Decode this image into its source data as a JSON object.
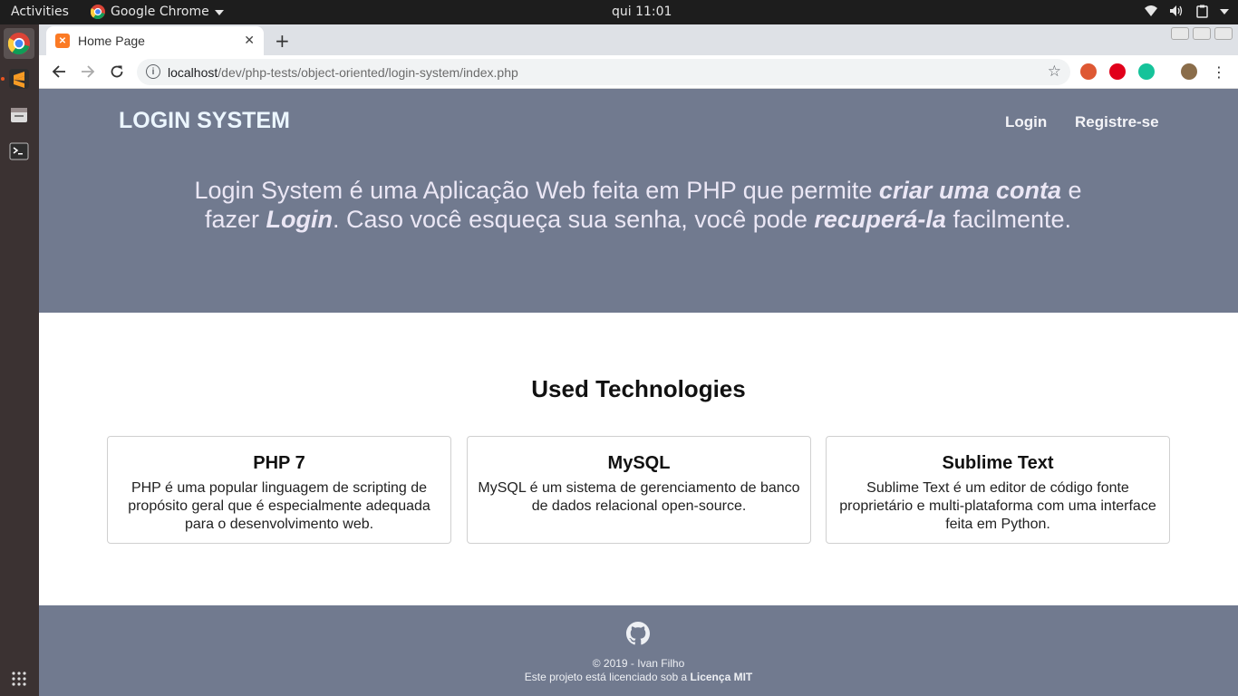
{
  "system": {
    "activities": "Activities",
    "app_name": "Google Chrome",
    "clock": "qui 11:01"
  },
  "browser": {
    "tab_title": "Home Page",
    "url_host": "localhost",
    "url_path": "/dev/php-tests/object-oriented/login-system/index.php"
  },
  "header": {
    "brand": "LOGIN SYSTEM",
    "nav": [
      {
        "label": "Login"
      },
      {
        "label": "Registre-se"
      }
    ]
  },
  "hero": {
    "t1": "Login System é uma Aplicação Web feita em PHP que permite ",
    "b1": "criar uma conta",
    "t2": " e fazer ",
    "b2": "Login",
    "t3": ". Caso você esqueça sua senha, você pode ",
    "b3": "recuperá-la",
    "t4": " facilmente."
  },
  "technologies": {
    "title": "Used Technologies",
    "cards": [
      {
        "title": "PHP 7",
        "text": "PHP é uma popular linguagem de scripting de propósito geral que é especialmente adequada para o desenvolvimento web."
      },
      {
        "title": "MySQL",
        "text": "MySQL é um sistema de gerenciamento de banco de dados relacional open-source."
      },
      {
        "title": "Sublime Text",
        "text": "Sublime Text é um editor de código fonte proprietário e multi-plataforma com uma interface feita em Python."
      }
    ]
  },
  "footer": {
    "copyright": "© 2019 - Ivan Filho",
    "license_text": "Este projeto está licenciado sob a ",
    "license_link": "Licença MIT"
  },
  "colors": {
    "hero_bg": "#717a8f",
    "dock_bg": "#3b3232",
    "topbar_bg": "#1d1d1d"
  }
}
